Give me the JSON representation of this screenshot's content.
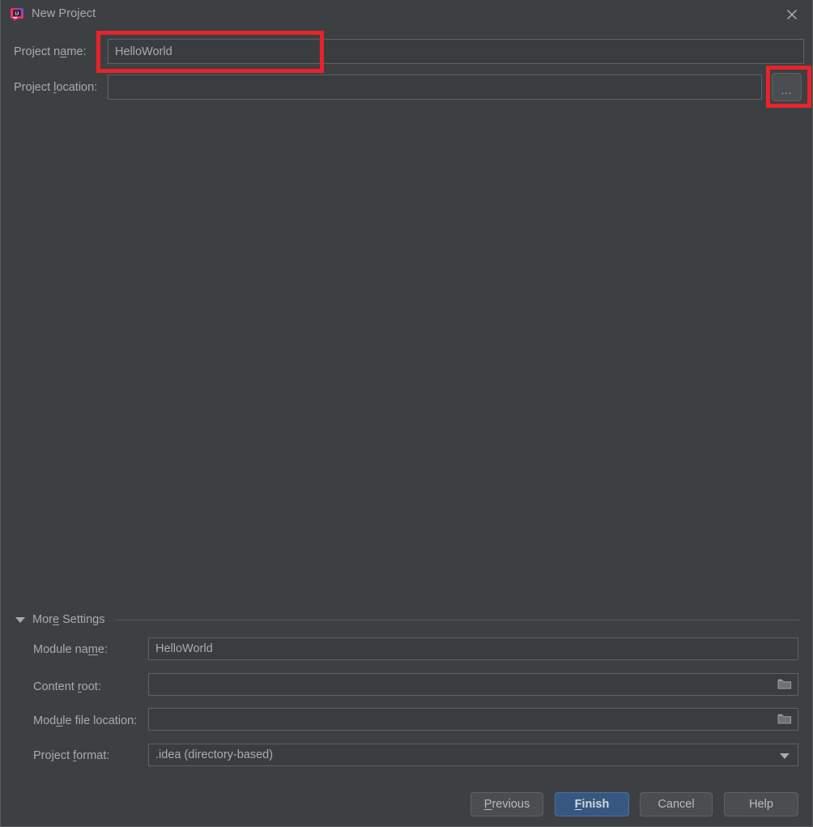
{
  "window": {
    "title": "New Project",
    "app_icon": "intellij-idea-icon",
    "close_icon": "close-icon",
    "background_color": "#3c4042",
    "accent_color": "#365880",
    "annotation_color": "#e8232a"
  },
  "form": {
    "project_name": {
      "label": "Project name:",
      "label_before": "Project n",
      "label_mnemonic": "a",
      "label_after": "me:",
      "value": "HelloWorld",
      "placeholder": "",
      "highlighted": true
    },
    "project_location": {
      "label": "Project location:",
      "label_before": "Project ",
      "label_mnemonic": "l",
      "label_after": "ocation:",
      "value": "",
      "placeholder": "",
      "browse_button_label": "...",
      "browse_icon": "ellipsis-icon",
      "browse_highlighted": true
    }
  },
  "more_settings": {
    "label": "More Settings",
    "label_before": "Mor",
    "label_mnemonic": "e",
    "label_after": " Settings",
    "expanded": true,
    "toggle_icon": "triangle-down-icon",
    "fields": {
      "module_name": {
        "label": "Module name:",
        "label_before": "Module na",
        "label_mnemonic": "m",
        "label_after": "e:",
        "value": "HelloWorld",
        "placeholder": ""
      },
      "content_root": {
        "label": "Content root:",
        "label_before": "Content ",
        "label_mnemonic": "r",
        "label_after": "oot:",
        "value": "",
        "placeholder": "",
        "browse_icon": "folder-icon"
      },
      "module_file_location": {
        "label": "Module file location:",
        "label_before": "Mod",
        "label_mnemonic": "u",
        "label_after": "le file location:",
        "value": "",
        "placeholder": "",
        "browse_icon": "folder-icon"
      },
      "project_format": {
        "label": "Project format:",
        "label_before": "Project ",
        "label_mnemonic": "f",
        "label_after": "ormat:",
        "value": ".idea (directory-based)",
        "dropdown_icon": "chevron-down-icon",
        "options": [
          ".idea (directory-based)"
        ]
      }
    }
  },
  "footer": {
    "previous": {
      "before": "",
      "mnemonic": "P",
      "after": "revious"
    },
    "finish": {
      "before": "",
      "mnemonic": "F",
      "after": "inish",
      "is_default": true
    },
    "cancel": {
      "before": "Cancel",
      "mnemonic": "",
      "after": ""
    },
    "help": {
      "before": "Help",
      "mnemonic": "",
      "after": ""
    }
  }
}
